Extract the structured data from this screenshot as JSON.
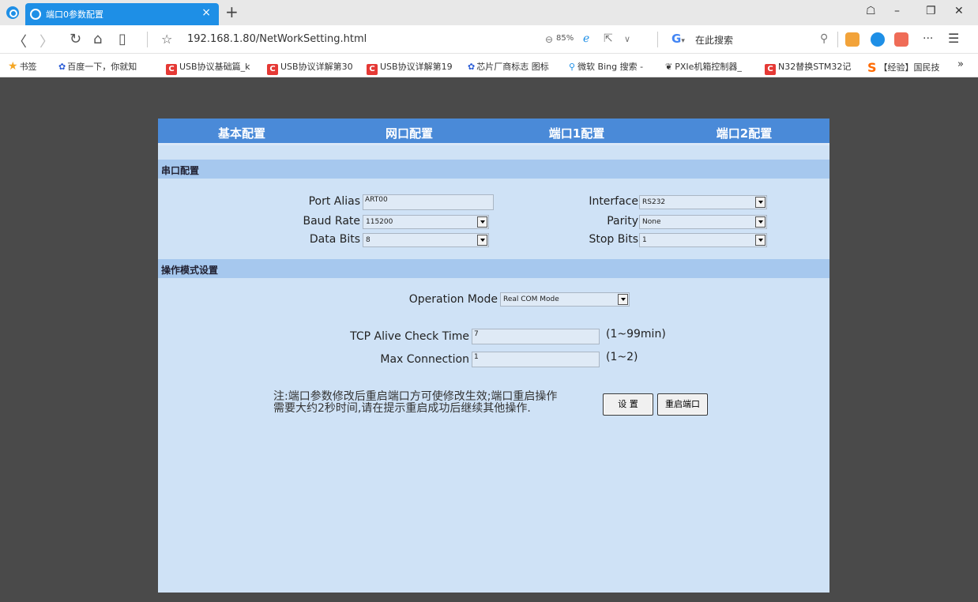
{
  "browser": {
    "tab_title": "端口0参数配置",
    "tab_close": "×",
    "new_tab": "+",
    "window_controls": {
      "skin": "☖",
      "minimize": "–",
      "restore": "❐",
      "close": "✕"
    },
    "nav": {
      "back": "〈",
      "forward": "〉",
      "reload": "↻",
      "home": "⌂",
      "reader": "▯",
      "star": "☆"
    },
    "url": "192.168.1.80/NetWorkSetting.html",
    "zoom": "85%",
    "search_engine_letter": "G",
    "search_placeholder": "在此搜索",
    "bookmarks": [
      {
        "label": "书签",
        "icon": "star"
      },
      {
        "label": "百度一下，你就知",
        "icon": "paw"
      },
      {
        "label": "USB协议基础篇_k",
        "icon": "c"
      },
      {
        "label": "USB协议详解第30",
        "icon": "c"
      },
      {
        "label": "USB协议详解第19",
        "icon": "c"
      },
      {
        "label": "芯片厂商标志 图标",
        "icon": "paw"
      },
      {
        "label": "微软 Bing 搜索 -",
        "icon": "search"
      },
      {
        "label": "PXIe机箱控制器_",
        "icon": "leaf"
      },
      {
        "label": "N32替换STM32记",
        "icon": "c"
      },
      {
        "label": "【经验】国民技",
        "icon": "s"
      }
    ],
    "bookmarks_more": "»"
  },
  "menu": [
    "基本配置",
    "网口配置",
    "端口1配置",
    "端口2配置"
  ],
  "serial": {
    "heading": "串口配置",
    "port_alias_label": "Port Alias",
    "port_alias_value": "ART00",
    "interface_label": "Interface",
    "interface_value": "RS232",
    "baud_label": "Baud Rate",
    "baud_value": "115200",
    "parity_label": "Parity",
    "parity_value": "None",
    "databits_label": "Data Bits",
    "databits_value": "8",
    "stopbits_label": "Stop Bits",
    "stopbits_value": "1"
  },
  "opmode": {
    "heading": "操作模式设置",
    "mode_label": "Operation Mode",
    "mode_value": "Real COM Mode",
    "tcp_label": "TCP Alive Check Time",
    "tcp_value": "7",
    "tcp_hint": "(1~99min)",
    "maxconn_label": "Max Connection",
    "maxconn_value": "1",
    "maxconn_hint": "(1~2)"
  },
  "note_line1": "注:端口参数修改后重启端口方可使修改生效;端口重启操作",
  "note_line2": "需要大约2秒时间,请在提示重启成功后继续其他操作.",
  "buttons": {
    "set": "设 置",
    "restart": "重启端口"
  }
}
